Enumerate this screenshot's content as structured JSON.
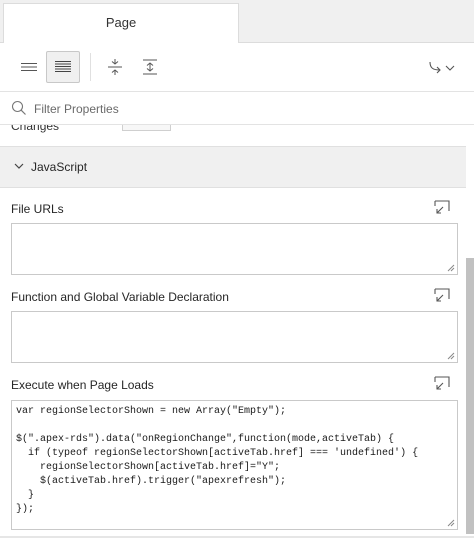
{
  "tabs": [
    {
      "label": "Page"
    }
  ],
  "toolbar": {
    "icons": [
      "show-common-icon",
      "show-all-icon",
      "collapse-all-icon",
      "expand-all-icon",
      "go-to-group-icon"
    ],
    "active_index": 1
  },
  "filter": {
    "placeholder": "Filter Properties",
    "value": ""
  },
  "properties": {
    "partial_label": "Changes",
    "section": {
      "title": "JavaScript",
      "expanded": true
    },
    "file_urls": {
      "label": "File URLs",
      "value": ""
    },
    "function_decl": {
      "label": "Function and Global Variable Declaration",
      "value": ""
    },
    "execute_on_load": {
      "label": "Execute when Page Loads",
      "code": "var regionSelectorShown = new Array(\"Empty\");\n\n$(\".apex-rds\").data(\"onRegionChange\",function(mode,activeTab) {\n  if (typeof regionSelectorShown[activeTab.href] === 'undefined') {\n    regionSelectorShown[activeTab.href]=\"Y\";\n    $(activeTab.href).trigger(\"apexrefresh\");\n  }\n});"
    }
  }
}
